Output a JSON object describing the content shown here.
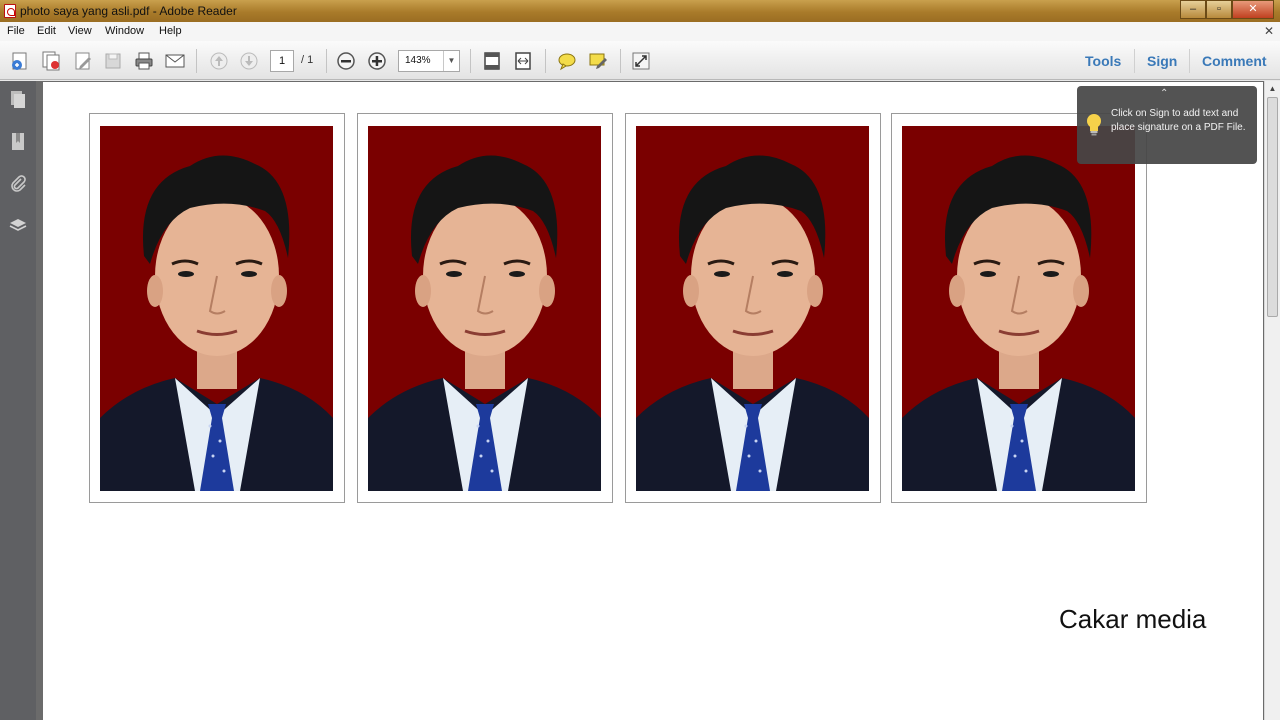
{
  "window": {
    "title": "photo saya yang asli.pdf - Adobe Reader",
    "controls": {
      "minimize": "–",
      "restore": "▫",
      "close": "✕"
    }
  },
  "menu": {
    "items": [
      "File",
      "Edit",
      "View",
      "Window",
      "Help"
    ],
    "close_glyph": "✕"
  },
  "toolbar": {
    "page_current": "1",
    "page_total": "/ 1",
    "zoom_value": "143%",
    "zoom_dropdown": "▼",
    "tools_label": "Tools",
    "sign_label": "Sign",
    "comment_label": "Comment",
    "icons": [
      "create-pdf-icon",
      "combine-files-icon",
      "edit-icon",
      "save-icon",
      "print-icon",
      "email-icon",
      "previous-page-icon",
      "next-page-icon",
      "zoom-out-icon",
      "zoom-in-icon",
      "fit-page-icon",
      "fit-width-icon",
      "comment-note-icon",
      "highlight-icon",
      "read-mode-icon"
    ]
  },
  "nav_panel": {
    "icons": [
      "page-thumbnails-icon",
      "bookmarks-icon",
      "attachments-icon",
      "layers-icon"
    ]
  },
  "tooltip": {
    "text": "Click on Sign to add text and place signature on a PDF File.",
    "caret": "⌃"
  },
  "document": {
    "photo_count": 4,
    "background_color": "#7a0000",
    "watermark": "Cakar media"
  },
  "scrollbar": {
    "up_arrow": "▲"
  },
  "colors": {
    "titlebar": "#a97b2a",
    "link_blue": "#3a79b8",
    "photo_background": "#7a0000",
    "suit": "#14182a",
    "tie": "#1d3a9c"
  }
}
